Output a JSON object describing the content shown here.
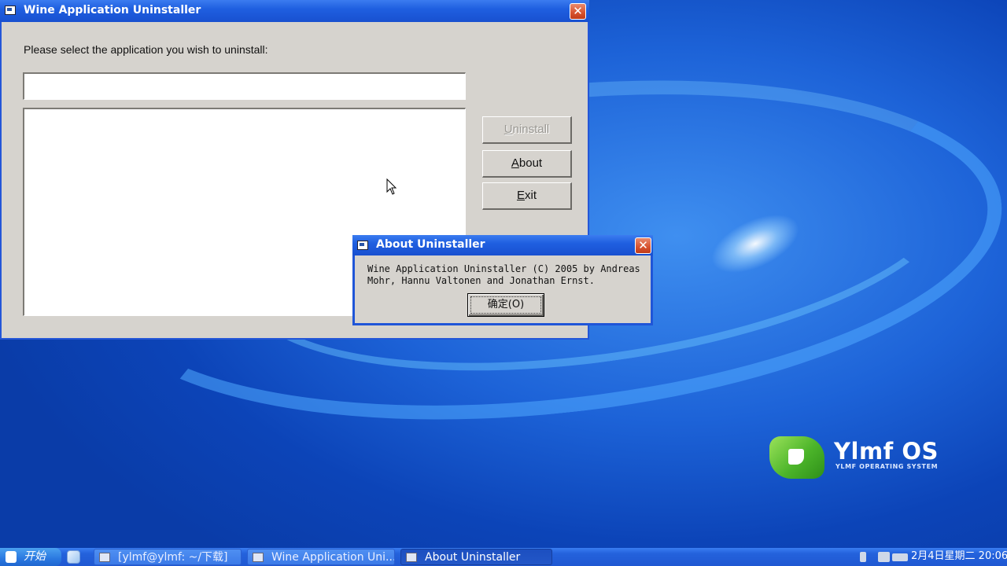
{
  "main_window": {
    "title": "Wine Application Uninstaller",
    "close_glyph": "✕",
    "prompt": "Please select the application you wish to uninstall:",
    "search_value": "",
    "buttons": {
      "uninstall": {
        "pre": "",
        "mnemonic": "U",
        "post": "ninstall",
        "enabled": false
      },
      "about": {
        "pre": "",
        "mnemonic": "A",
        "post": "bout",
        "enabled": true
      },
      "exit": {
        "pre": "",
        "mnemonic": "E",
        "post": "xit",
        "enabled": true
      }
    }
  },
  "about_dialog": {
    "title": "About Uninstaller",
    "close_glyph": "✕",
    "text_line1": "Wine Application Uninstaller (C) 2005 by Andreas",
    "text_line2": "Mohr, Hannu Valtonen and Jonathan Ernst.",
    "ok_label": "确定(O)"
  },
  "desktop": {
    "logo_title": "Ylmf OS",
    "logo_subtitle": "YLMF OPERATING SYSTEM"
  },
  "taskbar": {
    "start_label": "开始",
    "tasks": [
      {
        "label": "[ylmf@ylmf: ~/下载]",
        "active": false
      },
      {
        "label": "Wine Application Uni...",
        "active": false
      },
      {
        "label": "About Uninstaller",
        "active": true
      }
    ],
    "clock": "2月4日星期二 20:06"
  },
  "colors": {
    "titlebar": "#1f5fe0",
    "window_face": "#d6d3ce",
    "close_button": "#d7522e",
    "taskbar": "#2462dc"
  }
}
